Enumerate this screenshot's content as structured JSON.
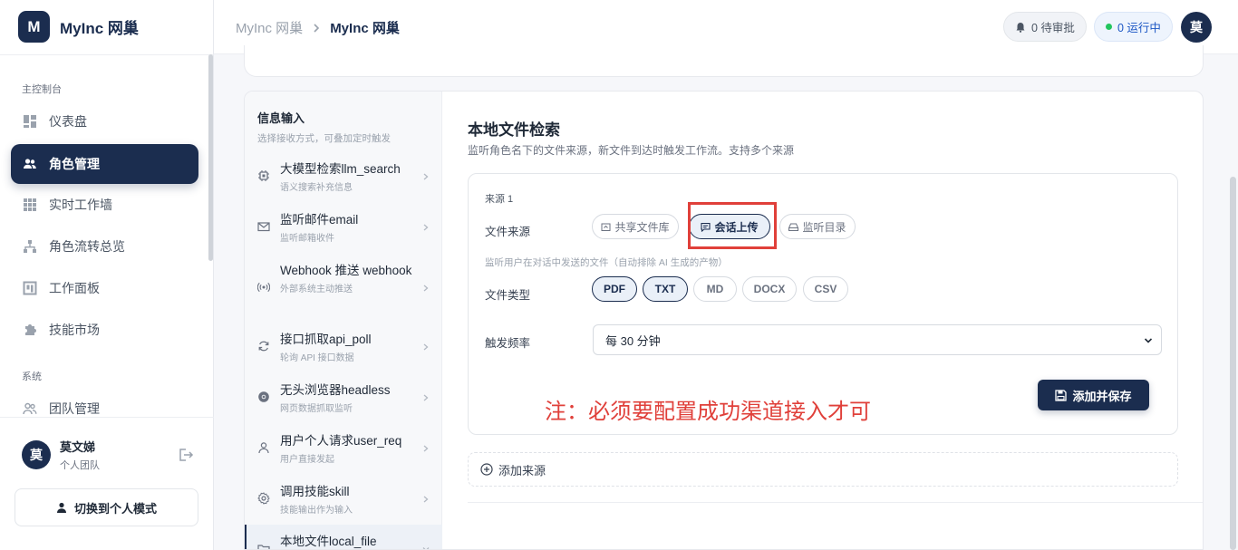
{
  "brand": {
    "logo_letter": "M",
    "name": "MyInc 网巢"
  },
  "sidebar": {
    "section_main": "主控制台",
    "section_system": "系统",
    "items": [
      {
        "label": "仪表盘",
        "icon": "dashboard-icon"
      },
      {
        "label": "角色管理",
        "icon": "users-icon",
        "active": true
      },
      {
        "label": "实时工作墙",
        "icon": "grid-icon"
      },
      {
        "label": "角色流转总览",
        "icon": "flow-icon"
      },
      {
        "label": "工作面板",
        "icon": "board-icon"
      },
      {
        "label": "技能市场",
        "icon": "puzzle-icon"
      }
    ],
    "system_items": [
      {
        "label": "团队管理",
        "icon": "team-icon"
      }
    ],
    "user": {
      "avatar": "莫",
      "name": "莫文娣",
      "team": "个人团队"
    },
    "switch_label": "切换到个人模式"
  },
  "header": {
    "breadcrumb_parent": "MyInc 网巢",
    "breadcrumb_current": "MyInc 网巢",
    "pending": "0 待审批",
    "running": "0 运行中",
    "avatar": "莫"
  },
  "sources_panel": {
    "title": "信息输入",
    "subtitle": "选择接收方式，可叠加定时触发",
    "items": [
      {
        "name": "大模型检索llm_search",
        "desc": "语义搜索补充信息",
        "icon": "chip-icon"
      },
      {
        "name": "监听邮件email",
        "desc": "监听邮箱收件",
        "icon": "mail-icon"
      },
      {
        "name": "Webhook 推送 webhook",
        "desc": "外部系统主动推送",
        "icon": "broadcast-icon"
      },
      {
        "name": "接口抓取api_poll",
        "desc": "轮询 API 接口数据",
        "icon": "refresh-icon"
      },
      {
        "name": "无头浏览器headless",
        "desc": "网页数据抓取监听",
        "icon": "browser-icon"
      },
      {
        "name": "用户个人请求user_req",
        "desc": "用户直接发起",
        "icon": "user-icon"
      },
      {
        "name": "调用技能skill",
        "desc": "技能输出作为输入",
        "icon": "gear-icon"
      },
      {
        "name": "本地文件local_file",
        "desc": "",
        "icon": "folder-icon",
        "active": true
      }
    ]
  },
  "detail": {
    "title": "本地文件检索",
    "subtitle": "监听角色名下的文件来源，新文件到达时触发工作流。支持多个来源",
    "source_label": "来源 1",
    "file_source_label": "文件来源",
    "file_source_options": [
      {
        "label": "共享文件库",
        "icon": "folder-share-icon",
        "selected": false
      },
      {
        "label": "会话上传",
        "icon": "chat-icon",
        "selected": true
      },
      {
        "label": "监听目录",
        "icon": "drive-icon",
        "selected": false
      }
    ],
    "hint": "监听用户在对话中发送的文件（自动排除 AI 生成的产物）",
    "file_type_label": "文件类型",
    "file_types": [
      {
        "label": "PDF",
        "selected": true
      },
      {
        "label": "TXT",
        "selected": true
      },
      {
        "label": "MD",
        "selected": false
      },
      {
        "label": "DOCX",
        "selected": false
      },
      {
        "label": "CSV",
        "selected": false
      }
    ],
    "frequency_label": "触发频率",
    "frequency_value": "每 30 分钟",
    "note": "注：必须要配置成功渠道接入才可",
    "save_label": "添加并保存",
    "add_source_label": "添加来源"
  },
  "colors": {
    "brand": "#1b2d4f",
    "highlight": "#e0403a",
    "status_green": "#22c55e"
  }
}
